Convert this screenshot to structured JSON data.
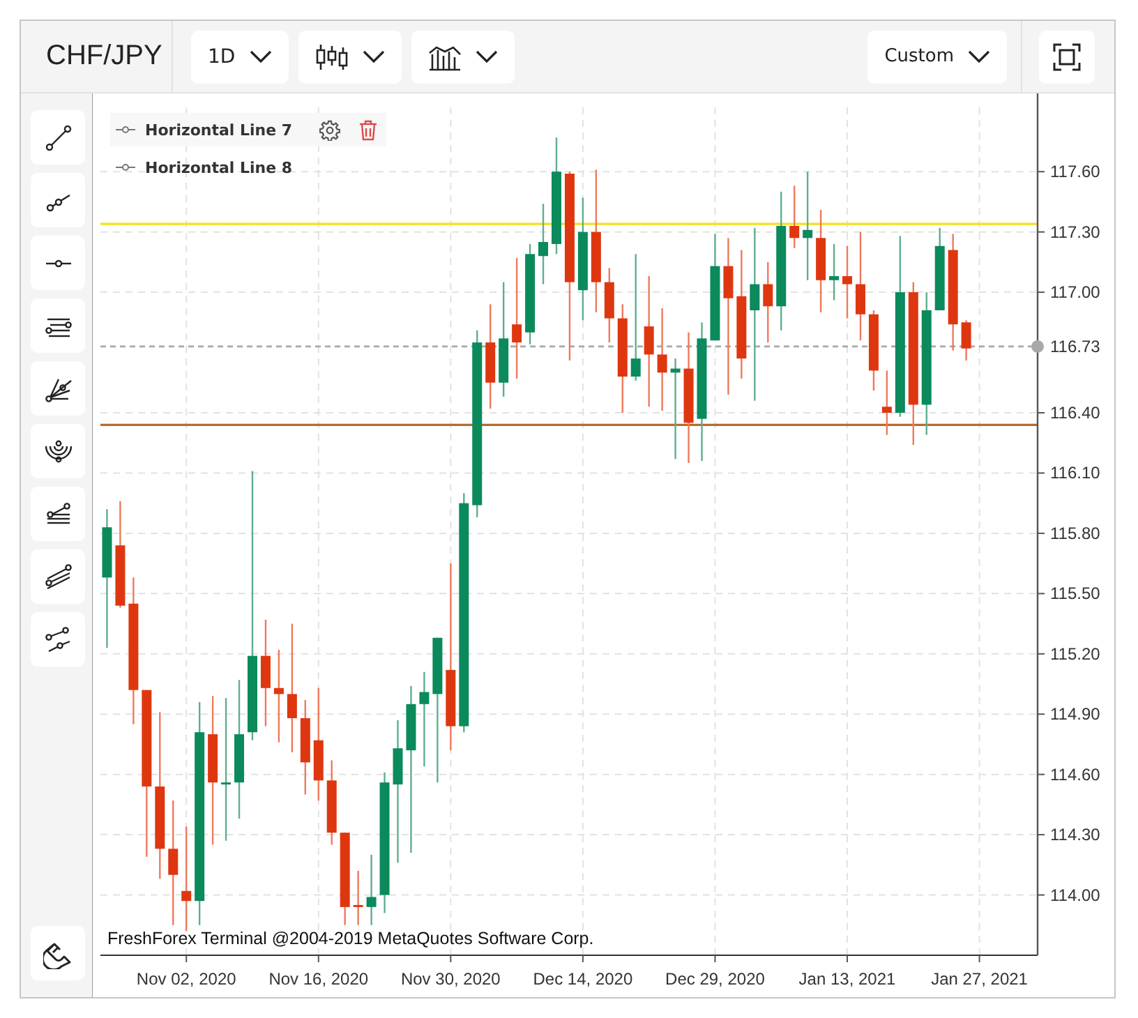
{
  "toolbar": {
    "symbol": "CHF/JPY",
    "timeframe": "1D",
    "range": "Custom"
  },
  "chart": {
    "legend": [
      {
        "label": "Horizontal Line 7",
        "hovered": true
      },
      {
        "label": "Horizontal Line 8",
        "hovered": false
      }
    ],
    "copyright": "FreshForex Terminal @2004-2019 MetaQuotes Software Corp.",
    "chart_data": {
      "type": "candlestick",
      "grid": true,
      "ylim": [
        113.7,
        117.92
      ],
      "categories": [
        null,
        null,
        null,
        null,
        null,
        null,
        "Nov 02, 2020",
        null,
        null,
        null,
        null,
        null,
        null,
        null,
        null,
        null,
        "Nov 16, 2020",
        null,
        null,
        null,
        null,
        null,
        null,
        null,
        null,
        null,
        "Nov 30, 2020",
        null,
        null,
        null,
        null,
        null,
        null,
        null,
        null,
        null,
        "Dec 14, 2020",
        null,
        null,
        null,
        null,
        null,
        null,
        null,
        null,
        null,
        "Dec 29, 2020",
        null,
        null,
        null,
        null,
        null,
        null,
        null,
        null,
        null,
        "Jan 13, 2021",
        null,
        null,
        null,
        null,
        null,
        null,
        null,
        null,
        null,
        "Jan 27, 2021"
      ],
      "yticks": [
        {
          "value": 117.6,
          "label": "117.60"
        },
        {
          "value": 117.3,
          "label": "117.30"
        },
        {
          "value": 117.0,
          "label": "117.00"
        },
        {
          "value": 116.4,
          "label": "116.40"
        },
        {
          "value": 116.1,
          "label": "116.10"
        },
        {
          "value": 115.8,
          "label": "115.80"
        },
        {
          "value": 115.5,
          "label": "115.50"
        },
        {
          "value": 115.2,
          "label": "115.20"
        },
        {
          "value": 114.9,
          "label": "114.90"
        },
        {
          "value": 114.6,
          "label": "114.60"
        },
        {
          "value": 114.3,
          "label": "114.30"
        },
        {
          "value": 114.0,
          "label": "114.00"
        }
      ],
      "ohlc": [
        [
          115.58,
          115.92,
          115.23,
          115.83
        ],
        [
          115.74,
          115.96,
          115.43,
          115.44
        ],
        [
          115.45,
          115.58,
          114.85,
          115.02
        ],
        [
          115.02,
          115.02,
          114.19,
          114.54
        ],
        [
          114.54,
          114.91,
          114.08,
          114.23
        ],
        [
          114.23,
          114.47,
          113.85,
          114.1
        ],
        [
          114.02,
          114.34,
          113.82,
          113.97
        ],
        [
          113.97,
          114.96,
          113.85,
          114.81
        ],
        [
          114.8,
          114.99,
          114.25,
          114.56
        ],
        [
          114.55,
          114.98,
          114.27,
          114.56
        ],
        [
          114.56,
          115.07,
          114.38,
          114.8
        ],
        [
          114.81,
          116.11,
          114.77,
          115.19
        ],
        [
          115.19,
          115.37,
          114.84,
          115.03
        ],
        [
          115.03,
          115.22,
          114.76,
          115.0
        ],
        [
          115.0,
          115.35,
          114.71,
          114.88
        ],
        [
          114.88,
          114.97,
          114.5,
          114.66
        ],
        [
          114.77,
          115.03,
          114.47,
          114.57
        ],
        [
          114.57,
          114.67,
          114.25,
          114.31
        ],
        [
          114.31,
          114.31,
          113.85,
          113.94
        ],
        [
          113.95,
          114.12,
          113.85,
          113.94
        ],
        [
          113.94,
          114.2,
          113.85,
          113.99
        ],
        [
          114.0,
          114.61,
          113.91,
          114.56
        ],
        [
          114.55,
          114.87,
          114.16,
          114.73
        ],
        [
          114.72,
          115.04,
          114.21,
          114.95
        ],
        [
          114.95,
          115.11,
          114.64,
          115.01
        ],
        [
          115.0,
          115.28,
          114.56,
          115.28
        ],
        [
          115.12,
          115.65,
          114.72,
          114.84
        ],
        [
          114.84,
          116.0,
          114.81,
          115.95
        ],
        [
          115.94,
          116.81,
          115.88,
          116.75
        ],
        [
          116.75,
          116.94,
          116.42,
          116.55
        ],
        [
          116.55,
          117.05,
          116.48,
          116.77
        ],
        [
          116.84,
          117.17,
          116.57,
          116.75
        ],
        [
          116.8,
          117.24,
          116.74,
          117.19
        ],
        [
          117.18,
          117.44,
          117.04,
          117.25
        ],
        [
          117.24,
          117.77,
          117.19,
          117.6
        ],
        [
          117.59,
          117.6,
          116.66,
          117.05
        ],
        [
          117.01,
          117.47,
          116.86,
          117.3
        ],
        [
          117.3,
          117.61,
          116.9,
          117.05
        ],
        [
          117.05,
          117.12,
          116.75,
          116.87
        ],
        [
          116.87,
          116.94,
          116.4,
          116.58
        ],
        [
          116.58,
          117.19,
          116.56,
          116.67
        ],
        [
          116.83,
          117.08,
          116.43,
          116.69
        ],
        [
          116.69,
          116.92,
          116.41,
          116.6
        ],
        [
          116.6,
          116.67,
          116.17,
          116.62
        ],
        [
          116.62,
          116.8,
          116.15,
          116.35
        ],
        [
          116.37,
          116.85,
          116.16,
          116.77
        ],
        [
          116.76,
          117.29,
          116.76,
          117.13
        ],
        [
          117.13,
          117.27,
          116.49,
          116.97
        ],
        [
          116.98,
          117.21,
          116.57,
          116.67
        ],
        [
          116.91,
          117.32,
          116.46,
          117.04
        ],
        [
          117.04,
          117.15,
          116.75,
          116.93
        ],
        [
          116.93,
          117.5,
          116.81,
          117.33
        ],
        [
          117.33,
          117.53,
          117.22,
          117.27
        ],
        [
          117.27,
          117.6,
          117.06,
          117.31
        ],
        [
          117.27,
          117.41,
          116.9,
          117.06
        ],
        [
          117.06,
          117.24,
          116.96,
          117.08
        ],
        [
          117.08,
          117.23,
          116.87,
          117.04
        ],
        [
          117.04,
          117.3,
          116.76,
          116.89
        ],
        [
          116.89,
          116.91,
          116.51,
          116.61
        ],
        [
          116.43,
          116.61,
          116.29,
          116.4
        ],
        [
          116.4,
          117.28,
          116.38,
          117.0
        ],
        [
          117.0,
          117.05,
          116.24,
          116.44
        ],
        [
          116.44,
          117.0,
          116.29,
          116.91
        ],
        [
          116.91,
          117.32,
          116.91,
          117.23
        ],
        [
          117.21,
          117.29,
          116.71,
          116.84
        ],
        [
          116.85,
          116.86,
          116.66,
          116.72
        ],
        null
      ],
      "ref_lines": [
        {
          "axis": "y",
          "value": 117.34,
          "color": "#f2e21b"
        },
        {
          "axis": "y",
          "value": 116.34,
          "color": "#b86b2b"
        },
        {
          "axis": "y",
          "value": 116.73,
          "color": "#a8a8a8",
          "label": "116.73"
        }
      ]
    }
  }
}
